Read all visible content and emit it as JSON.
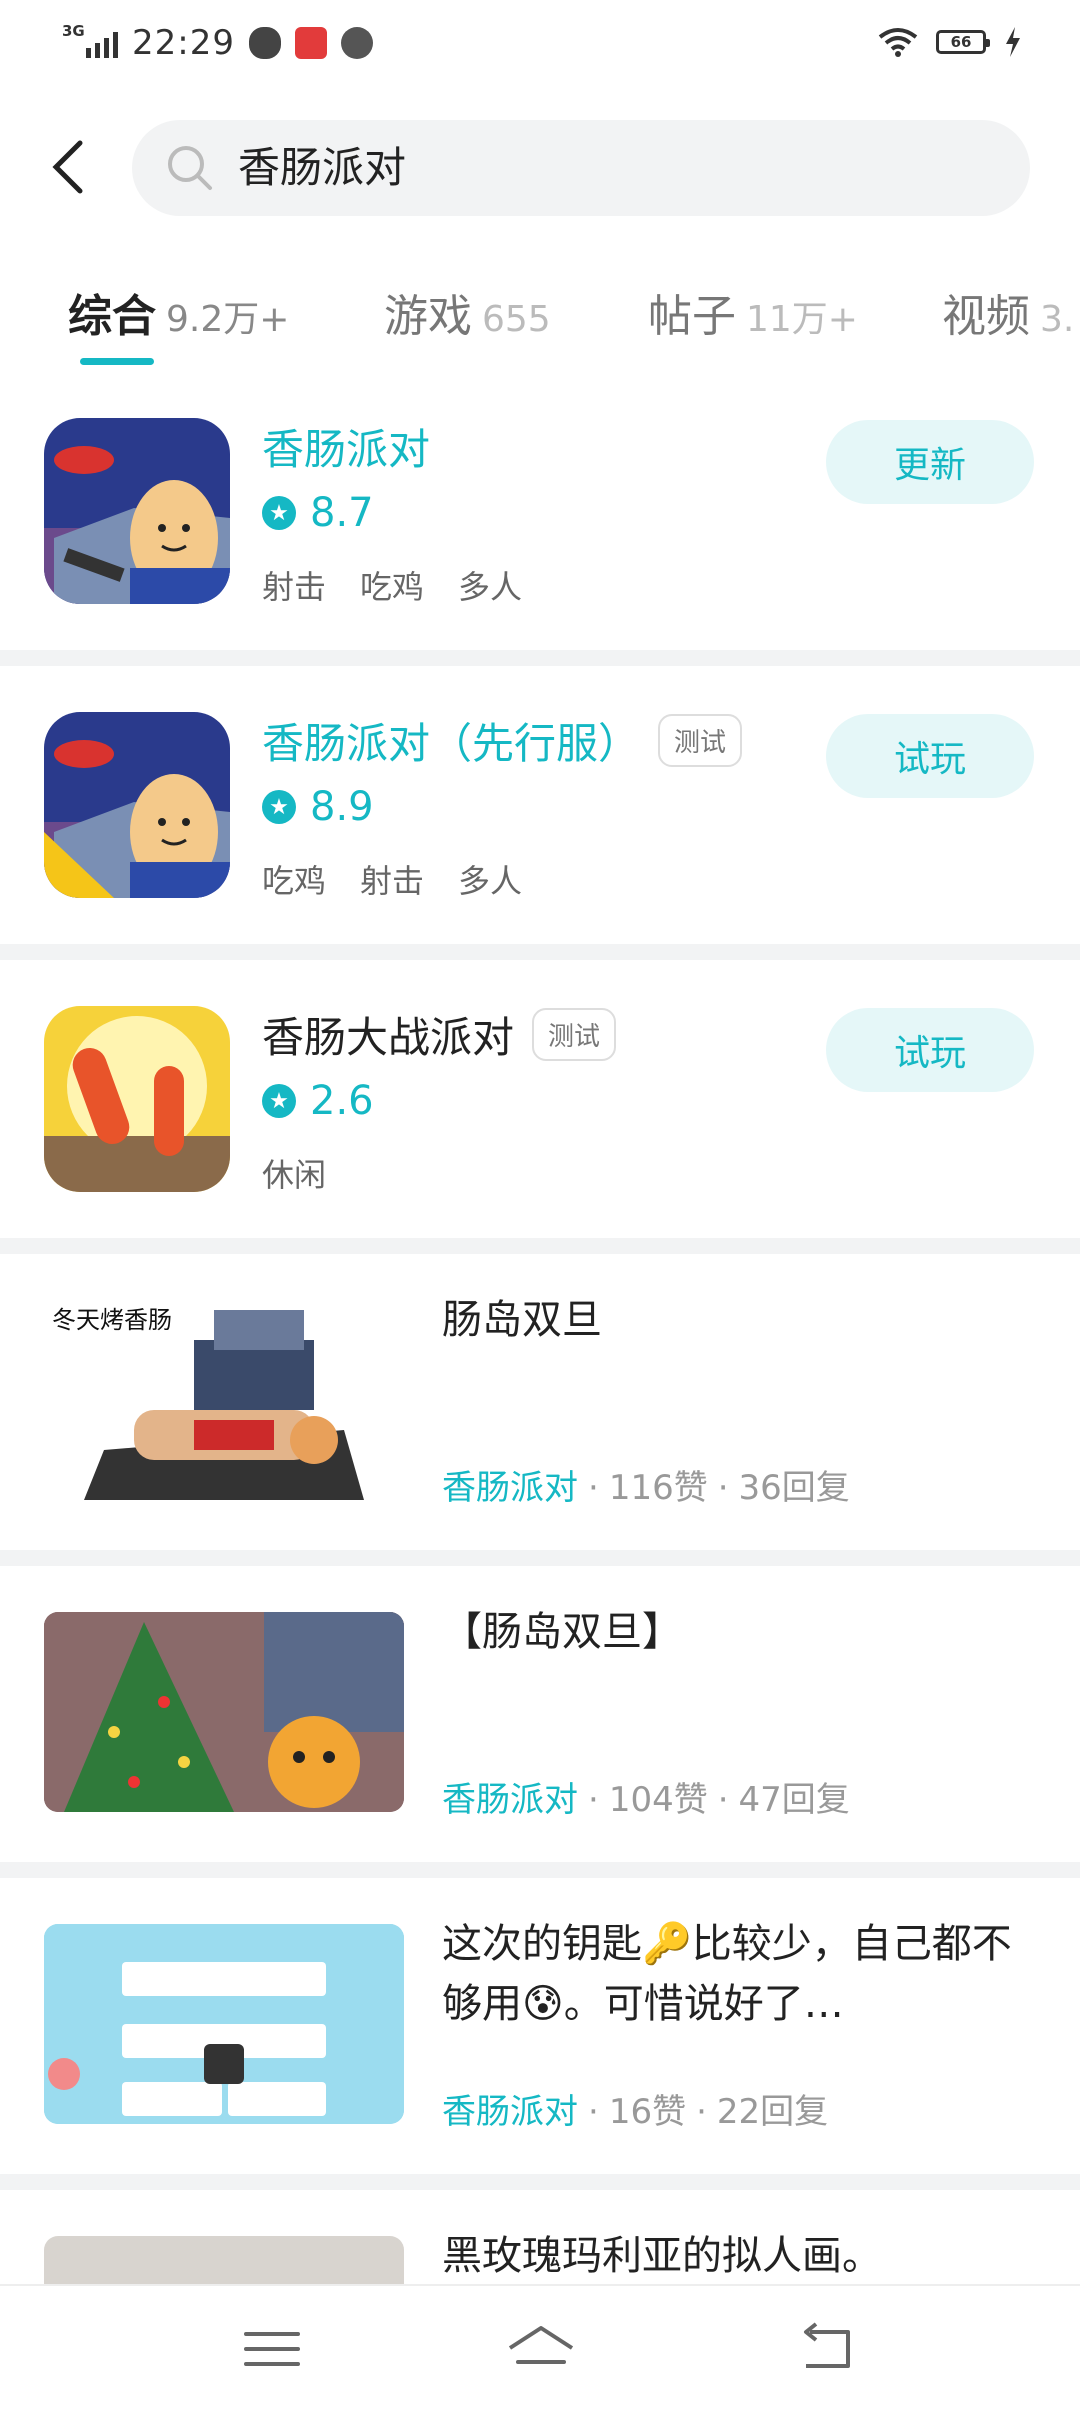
{
  "status_bar": {
    "network": "3G",
    "time": "22:29",
    "battery": "66"
  },
  "search": {
    "query": "香肠派对"
  },
  "tabs": [
    {
      "label": "综合",
      "count": "9.2万+"
    },
    {
      "label": "游戏",
      "count": "655"
    },
    {
      "label": "帖子",
      "count": "11万+"
    },
    {
      "label": "视频",
      "count": "3."
    }
  ],
  "games": [
    {
      "title": "香肠派对",
      "badge": "",
      "rating": "8.7",
      "tags": [
        "射击",
        "吃鸡",
        "多人"
      ],
      "action": "更新"
    },
    {
      "title": "香肠派对（先行服）",
      "badge": "测试",
      "rating": "8.9",
      "tags": [
        "吃鸡",
        "射击",
        "多人"
      ],
      "action": "试玩"
    },
    {
      "title": "香肠大战派对",
      "badge": "测试",
      "rating": "2.6",
      "tags": [
        "休闲"
      ],
      "action": "试玩"
    }
  ],
  "posts": [
    {
      "title": "肠岛双旦",
      "thumb_text": "冬天烤香肠",
      "game": "香肠派对",
      "likes": "116赞",
      "replies": "36回复"
    },
    {
      "title": "【肠岛双旦】",
      "thumb_text": "",
      "game": "香肠派对",
      "likes": "104赞",
      "replies": "47回复"
    },
    {
      "title": "这次的钥匙🔑比较少，自己都不够用😰。可惜说好了…",
      "thumb_text": "",
      "game": "香肠派对",
      "likes": "16赞",
      "replies": "22回复"
    },
    {
      "title": "黑玫瑰玛利亚的拟人画。",
      "thumb_text": "",
      "game": "",
      "likes": "",
      "replies": ""
    }
  ],
  "colors": {
    "accent": "#15b8c4",
    "accent_light": "#e5f7f8",
    "separator": "#f2f3f4"
  }
}
